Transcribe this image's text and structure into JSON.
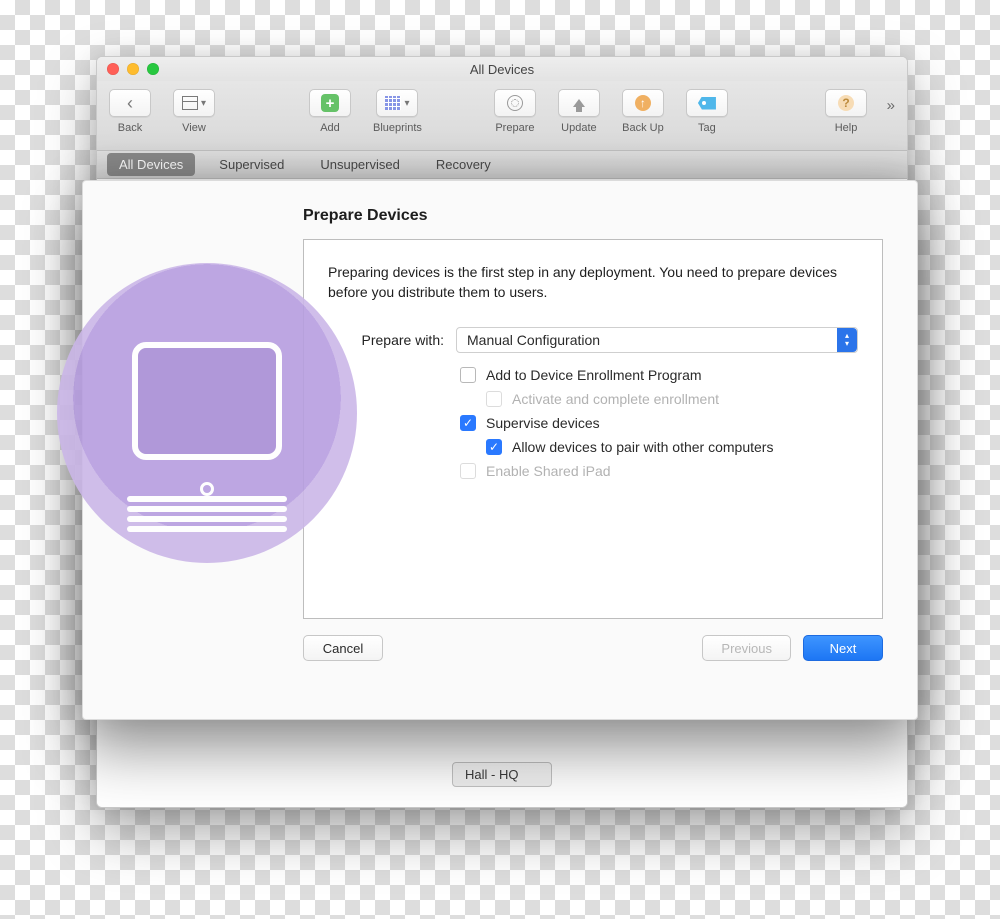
{
  "window": {
    "title": "All Devices"
  },
  "toolbar": {
    "back": "Back",
    "view": "View",
    "add": "Add",
    "blueprints": "Blueprints",
    "prepare": "Prepare",
    "update": "Update",
    "backup": "Back Up",
    "tag": "Tag",
    "help": "Help"
  },
  "scope": {
    "items": [
      "All Devices",
      "Supervised",
      "Unsupervised",
      "Recovery"
    ],
    "active_index": 0
  },
  "content": {
    "device_label": "Hall - HQ"
  },
  "sheet": {
    "title": "Prepare Devices",
    "intro": "Preparing devices is the first step in any deployment. You need to prepare devices before you distribute them to users.",
    "prepare_with_label": "Prepare with:",
    "prepare_with_value": "Manual Configuration",
    "checks": {
      "dep": {
        "label": "Add to Device Enrollment Program",
        "checked": false,
        "disabled": false
      },
      "activate": {
        "label": "Activate and complete enrollment",
        "checked": false,
        "disabled": true
      },
      "supervise": {
        "label": "Supervise devices",
        "checked": true,
        "disabled": false
      },
      "pair": {
        "label": "Allow devices to pair with other computers",
        "checked": true,
        "disabled": false
      },
      "shared": {
        "label": "Enable Shared iPad",
        "checked": false,
        "disabled": true
      }
    },
    "buttons": {
      "cancel": "Cancel",
      "previous": "Previous",
      "next": "Next"
    }
  }
}
